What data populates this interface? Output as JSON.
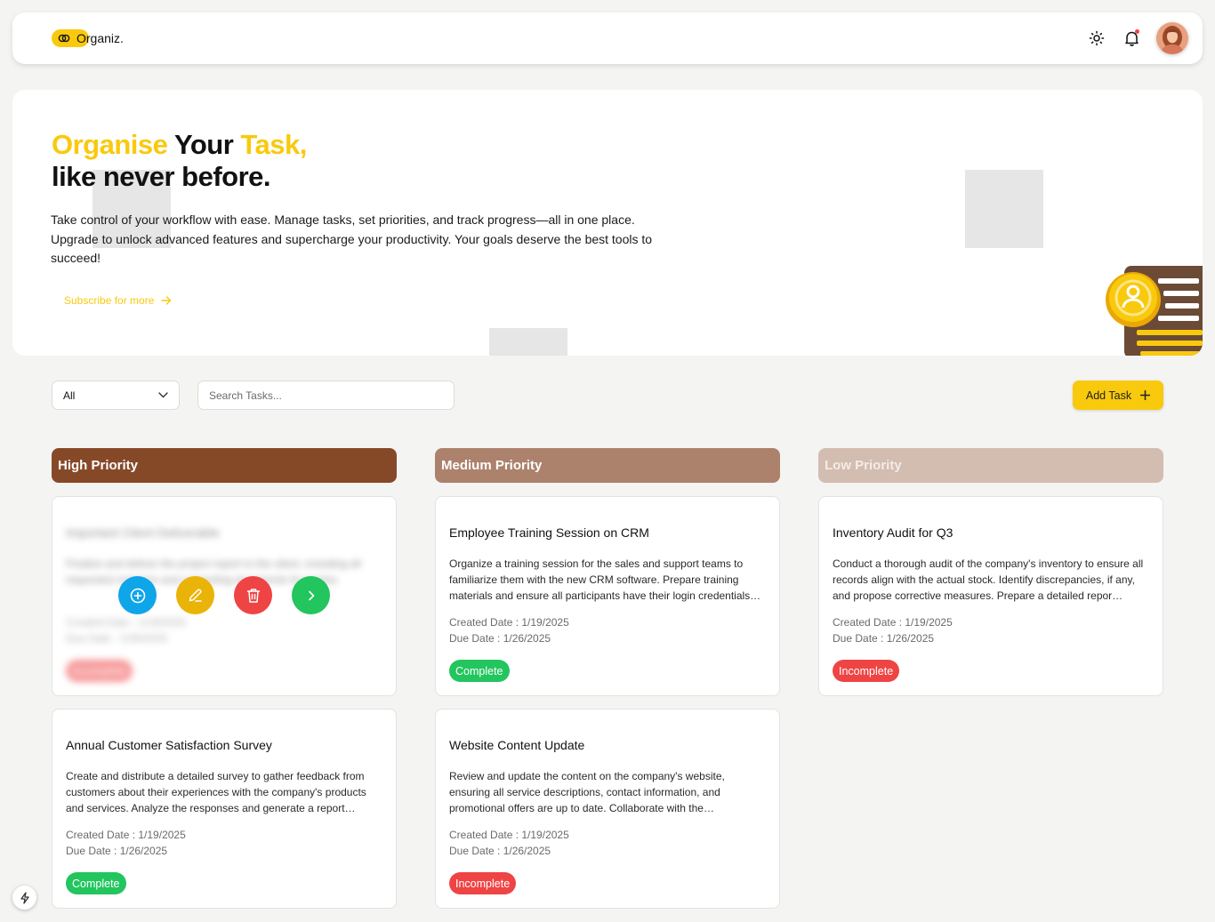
{
  "brand": {
    "name": "Organiz.",
    "accent": "#f9c90d"
  },
  "nav": {
    "theme_icon": "sun-icon",
    "notification_icon": "bell-icon",
    "avatar": "user-avatar"
  },
  "hero": {
    "title_word1": "Organise",
    "title_word2": "Your",
    "title_word3": "Task,",
    "title_line2": "like never before.",
    "description": "Take control of your workflow with ease. Manage tasks, set priorities, and track progress—all in one place. Upgrade to unlock advanced features and supercharge your productivity. Your goals deserve the best tools to succeed!",
    "cta_label": "Subscribe for more"
  },
  "toolbar": {
    "filter_value": "All",
    "search_placeholder": "Search Tasks...",
    "add_label": "Add Task"
  },
  "columns": [
    {
      "label": "High Priority",
      "color": "#864928"
    },
    {
      "label": "Medium Priority",
      "color": "#ac826c"
    },
    {
      "label": "Low Priority",
      "color": "#d3bcb0"
    }
  ],
  "cards": {
    "high_0": {
      "title": "Important Client Deliverable",
      "desc": "Finalize and deliver the project report to the client, including all requested revisions and supporting documents for review.",
      "created": "Created Date : 1/19/2025",
      "due": "Due Date : 1/26/2025",
      "status": "Incomplete"
    },
    "high_1": {
      "title": "Annual Customer Satisfaction Survey",
      "desc": "Create and distribute a detailed survey to gather feedback from customers about their experiences with the company's products and services. Analyze the responses and generate a report…",
      "created": "Created Date : 1/19/2025",
      "due": "Due Date : 1/26/2025",
      "status": "Complete"
    },
    "medium_0": {
      "title": "Employee Training Session on CRM",
      "desc": "Organize a training session for the sales and support teams to familiarize them with the new CRM software. Prepare training materials and ensure all participants have their login credentials…",
      "created": "Created Date : 1/19/2025",
      "due": "Due Date : 1/26/2025",
      "status": "Complete"
    },
    "medium_1": {
      "title": "Website Content Update",
      "desc": "Review and update the content on the company's website, ensuring all service descriptions, contact information, and promotional offers are up to date. Collaborate with the…",
      "created": "Created Date : 1/19/2025",
      "due": "Due Date : 1/26/2025",
      "status": "Incomplete"
    },
    "low_0": {
      "title": "Inventory Audit for Q3",
      "desc": "Conduct a thorough audit of the company's inventory to ensure all records align with the actual stock. Identify discrepancies, if any, and propose corrective measures. Prepare a detailed repor…",
      "created": "Created Date : 1/19/2025",
      "due": "Due Date : 1/26/2025",
      "status": "Incomplete"
    }
  },
  "status_colors": {
    "complete": "#22c55e",
    "incomplete": "#ef4444"
  },
  "card_actions": [
    "add-circle-icon",
    "pencil-icon",
    "trash-icon",
    "chevron-right-icon"
  ]
}
